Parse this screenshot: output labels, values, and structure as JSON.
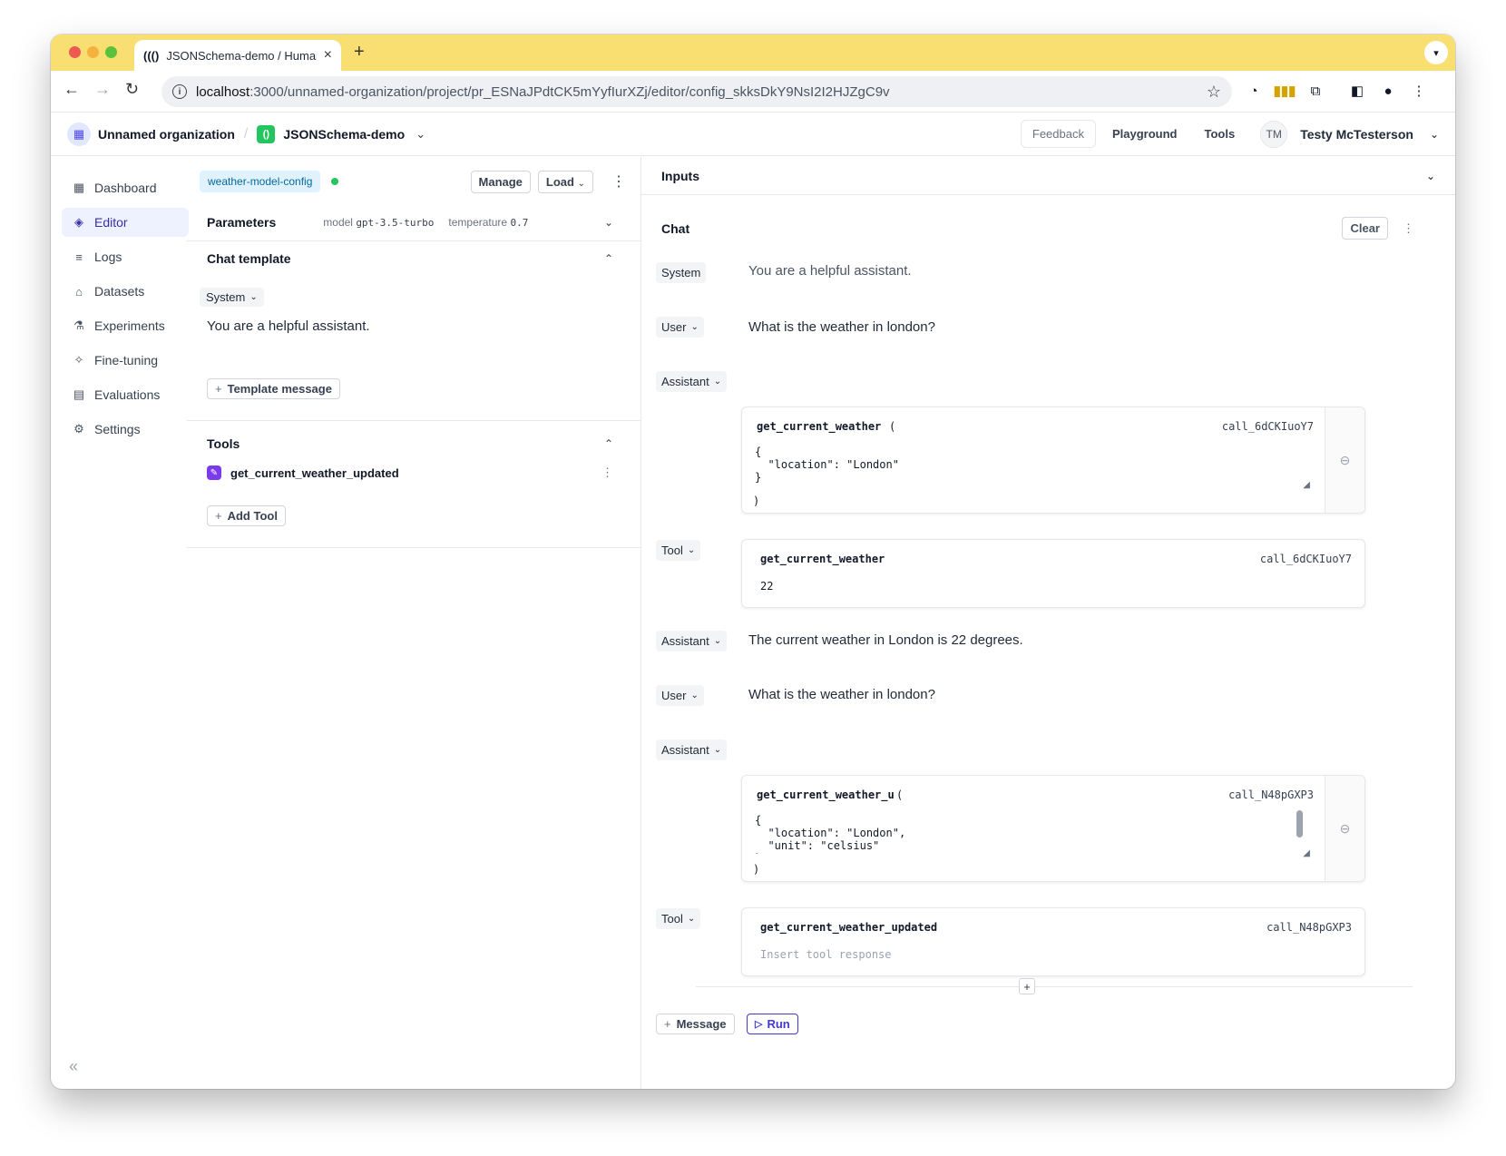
{
  "browser": {
    "tab_title": "JSONSchema-demo / Humanl",
    "url_host": "localhost",
    "url_path": ":3000/unnamed-organization/project/pr_ESNaJPdtCK5mYyfIurXZj/editor/config_skksDkY9NsI2I2HJZgC9v"
  },
  "header": {
    "org_name": "Unnamed organization",
    "separator": "/",
    "project_name": "JSONSchema-demo",
    "feedback_label": "Feedback",
    "playground_label": "Playground",
    "tools_label": "Tools",
    "user_initials": "TM",
    "user_name": "Testy McTesterson"
  },
  "sidebar": {
    "items": [
      {
        "label": "Dashboard",
        "icon": "grid-icon"
      },
      {
        "label": "Editor",
        "icon": "diamond-icon",
        "active": true
      },
      {
        "label": "Logs",
        "icon": "database-icon"
      },
      {
        "label": "Datasets",
        "icon": "box-icon"
      },
      {
        "label": "Experiments",
        "icon": "flask-icon"
      },
      {
        "label": "Fine-tuning",
        "icon": "sparkle-icon"
      },
      {
        "label": "Evaluations",
        "icon": "clipboard-icon"
      },
      {
        "label": "Settings",
        "icon": "gear-icon"
      }
    ]
  },
  "config": {
    "badge": "weather-model-config",
    "manage_label": "Manage",
    "load_label": "Load",
    "parameters": {
      "title": "Parameters",
      "model_key": "model",
      "model_value": "gpt-3.5-turbo",
      "temperature_key": "temperature",
      "temperature_value": "0.7"
    },
    "chat_template": {
      "title": "Chat template",
      "role": "System",
      "message": "You are a helpful assistant.",
      "add_label": "Template message"
    },
    "tools": {
      "title": "Tools",
      "items": [
        "get_current_weather_updated"
      ],
      "add_label": "Add Tool"
    }
  },
  "inputs": {
    "title": "Inputs"
  },
  "chat": {
    "title": "Chat",
    "clear_label": "Clear",
    "messages": [
      {
        "role": "System",
        "text": "You are a helpful assistant."
      },
      {
        "role": "User",
        "text": "What is the weather in london?"
      },
      {
        "role": "Assistant",
        "tool_call": {
          "name": "get_current_weather",
          "paren_open": "(",
          "paren_close": ")",
          "call_id": "call_6dCKIuoY7",
          "args": "{\n  \"location\": \"London\"\n}"
        }
      },
      {
        "role": "Tool",
        "tool_response": {
          "name": "get_current_weather",
          "call_id": "call_6dCKIuoY7",
          "content": "22"
        }
      },
      {
        "role": "Assistant",
        "text": "The current weather in London is 22 degrees."
      },
      {
        "role": "User",
        "text": "What is the weather in london?"
      },
      {
        "role": "Assistant",
        "tool_call": {
          "name": "get_current_weather_u",
          "paren_open": "(",
          "paren_close": ")",
          "call_id": "call_N48pGXP3",
          "args": "{\n  \"location\": \"London\",\n  \"unit\": \"celsius\"\n}"
        }
      },
      {
        "role": "Tool",
        "tool_response": {
          "name": "get_current_weather_updated",
          "call_id": "call_N48pGXP3",
          "placeholder": "Insert tool response"
        }
      }
    ],
    "add_message_label": "Message",
    "run_label": "Run"
  },
  "colors": {
    "tabbar": "#f9df72",
    "accent": "#3730a3",
    "badge_bg": "#e0f2fe",
    "status_green": "#22c55e",
    "tool_purple": "#7c3aed"
  }
}
